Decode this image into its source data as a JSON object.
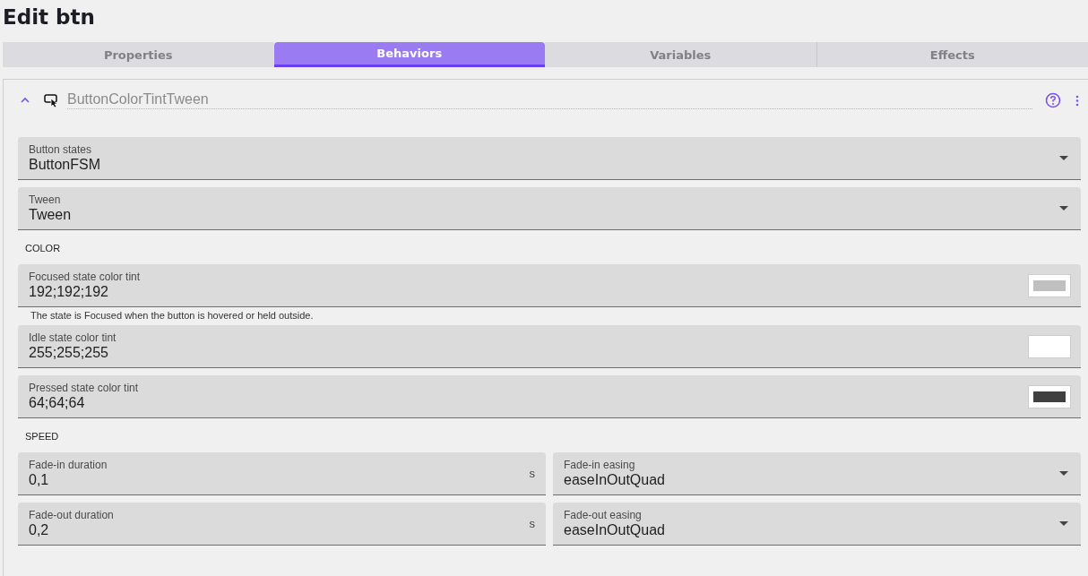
{
  "title": "Edit btn",
  "tabs": [
    {
      "label": "Properties",
      "selected": false
    },
    {
      "label": "Behaviors",
      "selected": true
    },
    {
      "label": "Variables",
      "selected": false
    },
    {
      "label": "Effects",
      "selected": false
    }
  ],
  "behavior": {
    "expanded": true,
    "name": "ButtonColorTintTween",
    "fields": [
      {
        "kind": "select",
        "label": "Button states",
        "value": "ButtonFSM"
      },
      {
        "kind": "select",
        "label": "Tween",
        "value": "Tween"
      },
      {
        "kind": "section",
        "label": "COLOR"
      },
      {
        "kind": "color",
        "label": "Focused state color tint",
        "value": "192;192;192",
        "color": "#c0c0c0",
        "helper": "The state is Focused when the button is hovered or held outside."
      },
      {
        "kind": "color",
        "label": "Idle state color tint",
        "value": "255;255;255",
        "color": "#ffffff"
      },
      {
        "kind": "color",
        "label": "Pressed state color tint",
        "value": "64;64;64",
        "color": "#404040"
      },
      {
        "kind": "section",
        "label": "SPEED"
      },
      {
        "kind": "pair",
        "items": [
          {
            "kind": "number",
            "label": "Fade-in duration",
            "value": "0,1",
            "unit": "s"
          },
          {
            "kind": "select",
            "label": "Fade-in easing",
            "value": "easeInOutQuad"
          }
        ]
      },
      {
        "kind": "pair",
        "items": [
          {
            "kind": "number",
            "label": "Fade-out duration",
            "value": "0,2",
            "unit": "s"
          },
          {
            "kind": "select",
            "label": "Fade-out easing",
            "value": "easeInOutQuad"
          }
        ]
      }
    ]
  }
}
